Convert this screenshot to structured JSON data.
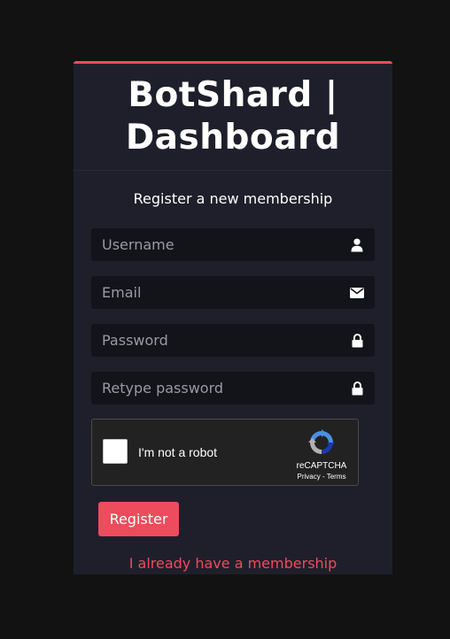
{
  "brand": {
    "line1": "BotShard |",
    "line2": "Dashboard"
  },
  "form": {
    "subtitle": "Register a new membership",
    "fields": [
      {
        "placeholder": "Username",
        "icon": "user-icon"
      },
      {
        "placeholder": "Email",
        "icon": "envelope-icon"
      },
      {
        "placeholder": "Password",
        "icon": "lock-icon"
      },
      {
        "placeholder": "Retype password",
        "icon": "lock-icon"
      }
    ],
    "captcha": {
      "label": "I'm not a robot",
      "brand": "reCAPTCHA",
      "links": "Privacy - Terms"
    },
    "register_label": "Register",
    "login_link": "I already have a membership"
  },
  "colors": {
    "accent": "#ed4c5c",
    "background": "#121212",
    "card": "#1f1f2b",
    "input": "#13131a"
  }
}
